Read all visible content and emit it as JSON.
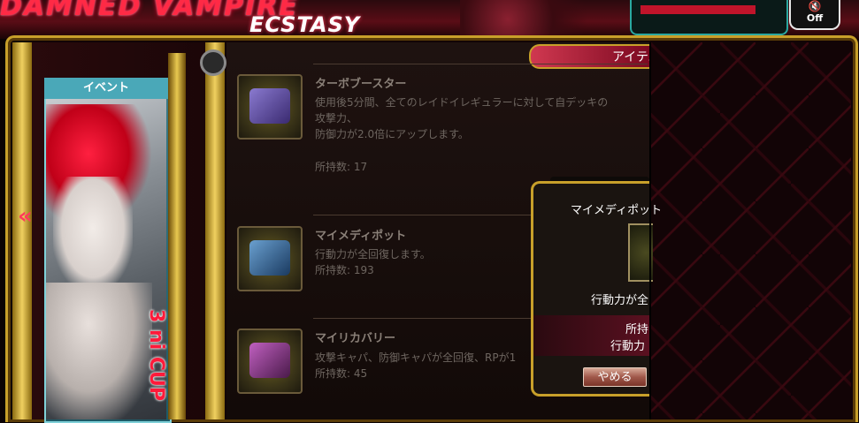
{
  "header": {
    "logo_main": "DAMNED VAMPIRE",
    "logo_sub": "ECSTASY",
    "sound_label": "Off",
    "sound_icon": "speaker-mute-icon"
  },
  "event": {
    "tab_label": "イベント",
    "banner_text": "3 ni CUP",
    "prev_arrow": "«"
  },
  "section": {
    "title": "アイテム"
  },
  "items": [
    {
      "name": "ターボブースター",
      "desc_line1": "使用後5分間、全てのレイドイレギュラーに対して自デッキの",
      "desc_line2": "攻撃力、",
      "desc_line3": "防御力が2.0倍にアップします。",
      "count": "所持数: 17",
      "icon": "turbo-booster-icon",
      "icon_color": "#5a4aa0"
    },
    {
      "name": "マイメディポット",
      "desc_line1": "行動力が全回復します。",
      "count": "所持数: 193",
      "icon": "medipot-icon",
      "icon_color": "#3a6aa0"
    },
    {
      "name": "マイリカバリー",
      "desc_line1": "攻撃キャパ、防御キャパが全回復、RPが1",
      "count": "所持数: 45",
      "icon": "recovery-icon",
      "icon_color": "#8a3a8a"
    }
  ],
  "dialog": {
    "title": "マイメディポット",
    "desc": "行動力が全",
    "count_line": "所持",
    "after_line": "行動力",
    "cancel_label": "やめる"
  },
  "colors": {
    "accent_red": "#ff2a45",
    "gold": "#c8a02a",
    "teal": "#4aa8b8"
  }
}
